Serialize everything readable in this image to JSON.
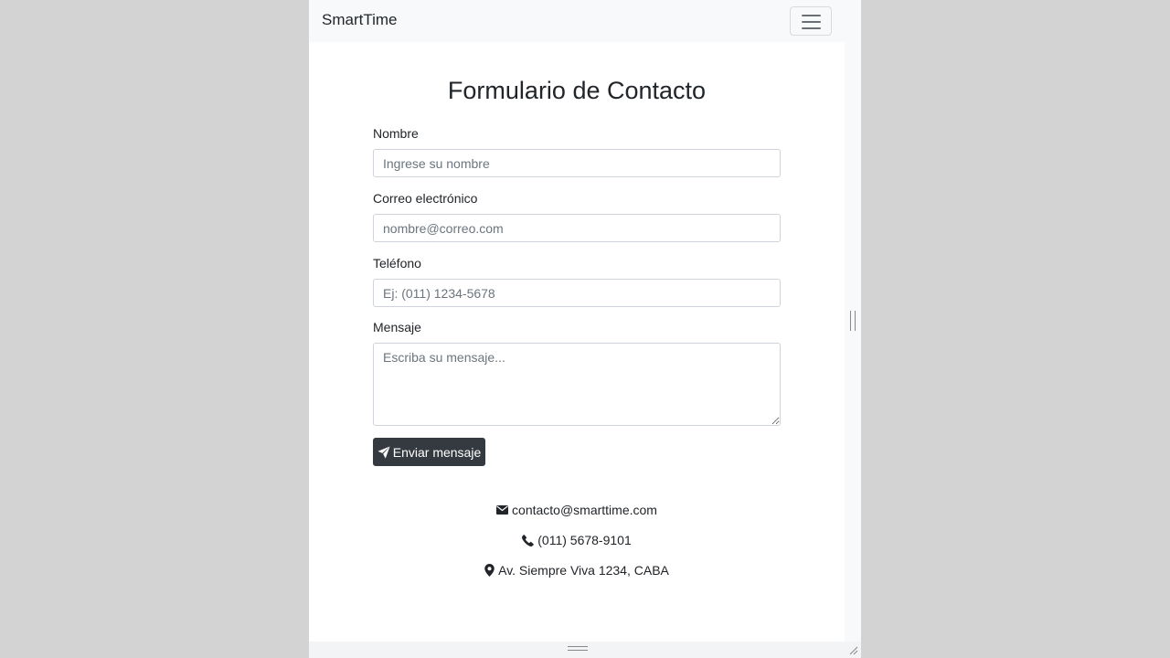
{
  "navbar": {
    "brand": "SmartTime",
    "toggle_icon": "hamburger-icon"
  },
  "form": {
    "title": "Formulario de Contacto",
    "name": {
      "label": "Nombre",
      "placeholder": "Ingrese su nombre",
      "value": ""
    },
    "email": {
      "label": "Correo electrónico",
      "placeholder": "nombre@correo.com",
      "value": ""
    },
    "phone": {
      "label": "Teléfono",
      "placeholder": "Ej: (011) 1234-5678",
      "value": ""
    },
    "message": {
      "label": "Mensaje",
      "placeholder": "Escriba su mensaje...",
      "value": ""
    },
    "submit": {
      "label": "Enviar mensaje",
      "icon": "paper-plane-icon"
    }
  },
  "contact_info": {
    "email": {
      "text": "contacto@smarttime.com",
      "icon": "envelope-icon"
    },
    "phone": {
      "text": "(011) 5678-9101",
      "icon": "phone-icon"
    },
    "address": {
      "text": "Av. Siempre Viva 1234, CABA",
      "icon": "map-marker-icon"
    }
  },
  "colors": {
    "page_bg": "#d3d3d3",
    "navbar_bg": "#f8f9fa",
    "button_bg": "#343a40",
    "text": "#212529"
  }
}
